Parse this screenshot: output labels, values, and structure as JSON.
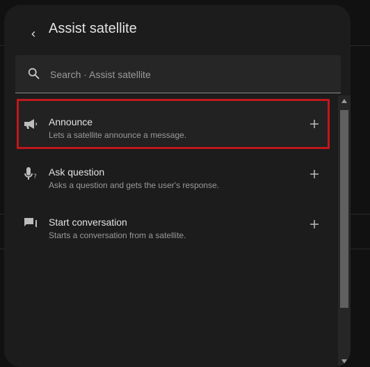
{
  "dialog": {
    "title": "Assist satellite"
  },
  "search": {
    "placeholder": "Search · Assist satellite",
    "value": ""
  },
  "items": [
    {
      "label": "Announce",
      "description": "Lets a satellite announce a message.",
      "icon": "megaphone-icon",
      "selected": true
    },
    {
      "label": "Ask question",
      "description": "Asks a question and gets the user's response.",
      "icon": "microphone-question-icon",
      "selected": false
    },
    {
      "label": "Start conversation",
      "description": "Starts a conversation from a satellite.",
      "icon": "chat-icon",
      "selected": false
    }
  ],
  "colors": {
    "selection_outline": "#c0181c",
    "dialog_bg": "#1c1c1c",
    "text_primary": "#e3e3e3",
    "text_secondary": "#9a9a9a"
  }
}
